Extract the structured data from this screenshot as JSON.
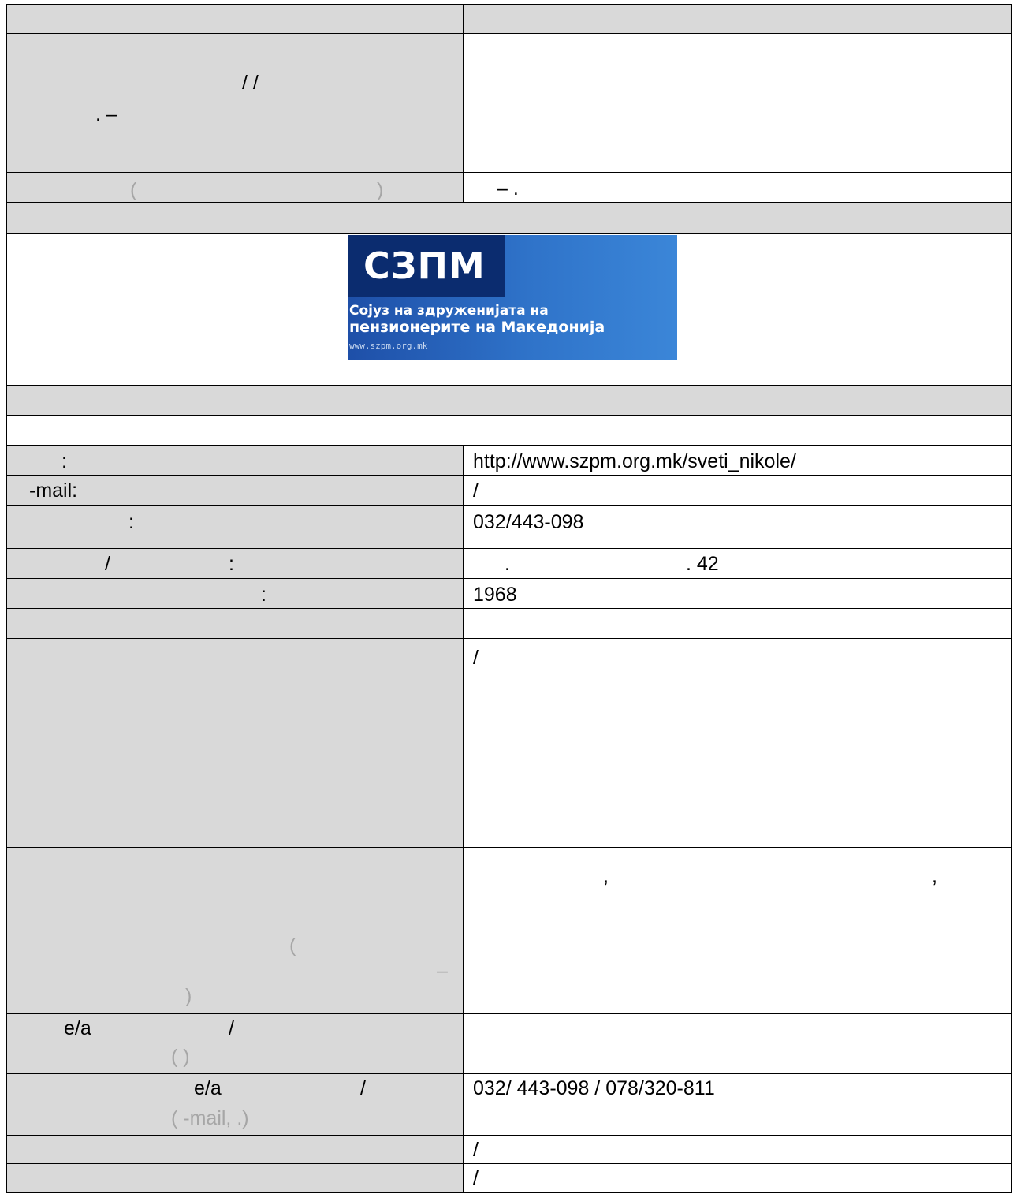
{
  "rows": {
    "r1_right": "",
    "r2_left_a": "/      /",
    "r2_left_b": ". –",
    "r3_left_a": "(",
    "r3_left_b": ")",
    "r3_right": "–      .",
    "website_label": ":",
    "website_value": "http://www.szpm.org.mk/sveti_nikole/",
    "email_label": "-mail:",
    "email_value": "/",
    "phone_label": ":",
    "phone_value": "032/443-098",
    "address_label_a": "/",
    "address_label_b": ":",
    "address_value_a": ".",
    "address_value_b": ". 42",
    "founded_label": ":",
    "founded_value": "1968",
    "activities_value": "/",
    "members_value_a": ",",
    "members_value_b": ",",
    "funding_a": "(",
    "funding_b": "–",
    "funding_c": ")",
    "contact_person_label_a": "e/a",
    "contact_person_label_b": "/",
    "contact_person_label_c": "(              )",
    "contact_info_label_a": "e/a",
    "contact_info_label_b": "/",
    "contact_info_label_c": "(  -mail,       .)",
    "contact_info_value": "032/ 443-098 / 078/320-811",
    "last1_value": "/",
    "last2_value": "/"
  },
  "logo": {
    "abbr": "СЗПМ",
    "line1": "Сојуз на здруженијата на",
    "line2": "пензионерите на Македонија",
    "url": "www.szpm.org.mk"
  }
}
